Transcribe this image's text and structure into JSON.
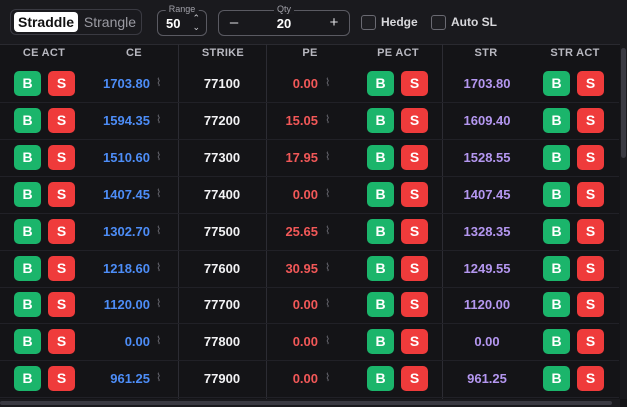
{
  "toolbar": {
    "mode_options": [
      "Straddle",
      "Strangle"
    ],
    "mode_selected": "Straddle",
    "range": {
      "label": "Range",
      "value": "50"
    },
    "qty": {
      "label": "Qty",
      "value": "20",
      "minus": "–",
      "plus": "+"
    },
    "hedge_label": "Hedge",
    "hedge_checked": false,
    "autosl_label": "Auto SL",
    "autosl_checked": false
  },
  "table": {
    "headers": [
      "CE ACT",
      "CE",
      "STRIKE",
      "PE",
      "PE ACT",
      "STR",
      "STR ACT"
    ],
    "buy_label": "B",
    "sell_label": "S",
    "rows": [
      {
        "ce": "1703.80",
        "strike": "77100",
        "pe": "0.00",
        "str": "1703.80"
      },
      {
        "ce": "1594.35",
        "strike": "77200",
        "pe": "15.05",
        "str": "1609.40"
      },
      {
        "ce": "1510.60",
        "strike": "77300",
        "pe": "17.95",
        "str": "1528.55"
      },
      {
        "ce": "1407.45",
        "strike": "77400",
        "pe": "0.00",
        "str": "1407.45"
      },
      {
        "ce": "1302.70",
        "strike": "77500",
        "pe": "25.65",
        "str": "1328.35"
      },
      {
        "ce": "1218.60",
        "strike": "77600",
        "pe": "30.95",
        "str": "1249.55"
      },
      {
        "ce": "1120.00",
        "strike": "77700",
        "pe": "0.00",
        "str": "1120.00"
      },
      {
        "ce": "0.00",
        "strike": "77800",
        "pe": "0.00",
        "str": "0.00"
      },
      {
        "ce": "961.25",
        "strike": "77900",
        "pe": "0.00",
        "str": "961.25"
      }
    ]
  },
  "colors": {
    "buy": "#1bb56b",
    "sell": "#ef3b3b",
    "ce_price": "#4d8df7",
    "pe_price": "#f25858",
    "straddle_price": "#b497f0",
    "background": "#141417"
  },
  "icons": {
    "chart": "chart-line-icon"
  }
}
